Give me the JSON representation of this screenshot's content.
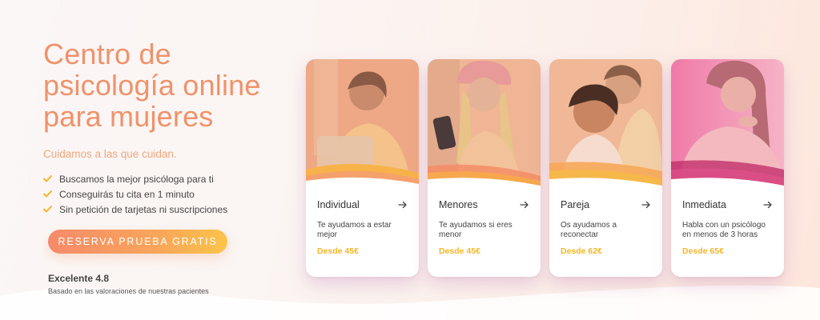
{
  "hero": {
    "title_lines": [
      "Centro de",
      "psicología online",
      "para mujeres"
    ],
    "tagline": "Cuidamos a las que cuidan.",
    "benefits": [
      "Buscamos la mejor psicóloga para ti",
      "Conseguirás tu cita en 1 minuto",
      "Sin petición de tarjetas ni suscripciones"
    ],
    "cta_label": "RESERVA PRUEBA GRATIS",
    "rating_score": "Excelente 4.8",
    "rating_note": "Basado en las valoraciones de nuestras pacientes"
  },
  "cards": [
    {
      "title": "Individual",
      "description": "Te ayudamos a estar mejor",
      "price": "Desde 45€"
    },
    {
      "title": "Menores",
      "description": "Te ayudamos si eres menor",
      "price": "Desde 45€"
    },
    {
      "title": "Pareja",
      "description": "Os ayudamos a reconectar",
      "price": "Desde 62€"
    },
    {
      "title": "Inmediata",
      "description": "Habla con un psicólogo en menos de 3 horas",
      "price": "Desde 65€"
    }
  ],
  "icons": {
    "benefit_check": "check-icon",
    "card_arrow": "arrow-right-icon"
  },
  "colors": {
    "accent": "#f0926b",
    "price": "#f5b52a",
    "check": "#f5b52a"
  }
}
